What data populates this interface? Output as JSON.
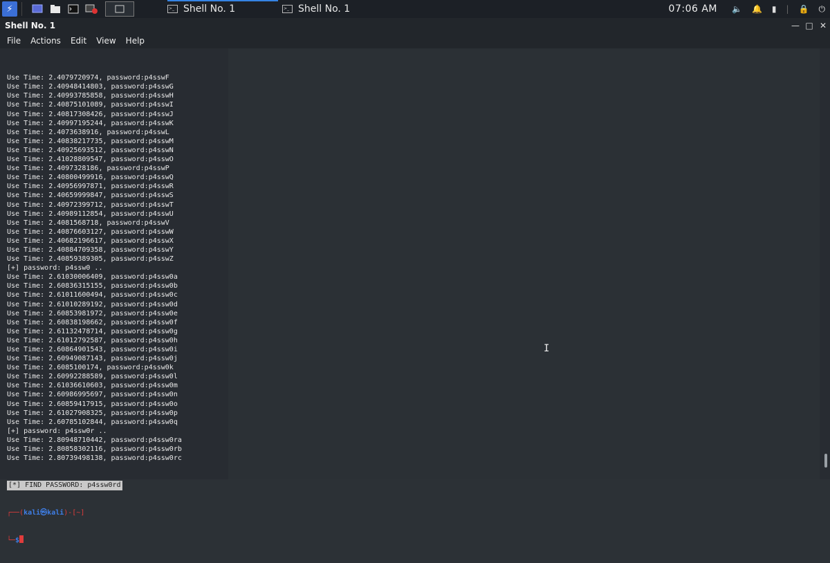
{
  "taskbar": {
    "tasks": [
      {
        "label": "Shell No. 1"
      },
      {
        "label": "Shell No. 1"
      }
    ],
    "clock": "07:06 AM"
  },
  "window": {
    "title": "Shell No. 1",
    "menu": [
      "File",
      "Actions",
      "Edit",
      "View",
      "Help"
    ]
  },
  "terminal": {
    "lines": [
      "Use Time: 2.4079720974, password:p4sswF",
      "Use Time: 2.40948414803, password:p4sswG",
      "Use Time: 2.40993785858, password:p4sswH",
      "Use Time: 2.40875101089, password:p4sswI",
      "Use Time: 2.40817308426, password:p4sswJ",
      "Use Time: 2.40997195244, password:p4sswK",
      "Use Time: 2.4073638916, password:p4sswL",
      "Use Time: 2.40838217735, password:p4sswM",
      "Use Time: 2.40925693512, password:p4sswN",
      "Use Time: 2.41028809547, password:p4sswO",
      "Use Time: 2.4097328186, password:p4sswP",
      "Use Time: 2.40800499916, password:p4sswQ",
      "Use Time: 2.40956997871, password:p4sswR",
      "Use Time: 2.40659999847, password:p4sswS",
      "Use Time: 2.40972399712, password:p4sswT",
      "Use Time: 2.40989112854, password:p4sswU",
      "Use Time: 2.4081568718, password:p4sswV",
      "Use Time: 2.40876603127, password:p4sswW",
      "Use Time: 2.40682196617, password:p4sswX",
      "Use Time: 2.40884709358, password:p4sswY",
      "Use Time: 2.40859389305, password:p4sswZ",
      "[+] password: p4ssw0 ..",
      "Use Time: 2.61030006409, password:p4ssw0a",
      "Use Time: 2.60836315155, password:p4ssw0b",
      "Use Time: 2.61011600494, password:p4ssw0c",
      "Use Time: 2.61010289192, password:p4ssw0d",
      "Use Time: 2.60853981972, password:p4ssw0e",
      "Use Time: 2.60838198662, password:p4ssw0f",
      "Use Time: 2.61132478714, password:p4ssw0g",
      "Use Time: 2.61012792587, password:p4ssw0h",
      "Use Time: 2.60864901543, password:p4ssw0i",
      "Use Time: 2.60949087143, password:p4ssw0j",
      "Use Time: 2.6085100174, password:p4ssw0k",
      "Use Time: 2.60992288589, password:p4ssw0l",
      "Use Time: 2.61036610603, password:p4ssw0m",
      "Use Time: 2.60986995697, password:p4ssw0n",
      "Use Time: 2.60859417915, password:p4ssw0o",
      "Use Time: 2.61027908325, password:p4ssw0p",
      "Use Time: 2.60785102844, password:p4ssw0q",
      "[+] password: p4ssw0r ..",
      "Use Time: 2.80948710442, password:p4ssw0ra",
      "Use Time: 2.80858302116, password:p4ssw0rb",
      "Use Time: 2.80739498138, password:p4ssw0rc"
    ],
    "find_line": "[*] FIND PASSWORD: p4ssw0rd",
    "prompt_open": "┌──(",
    "prompt_user": "kali㉿kali",
    "prompt_dir": ")-[~]",
    "prompt_close": "└─",
    "prompt_symbol": "$"
  }
}
